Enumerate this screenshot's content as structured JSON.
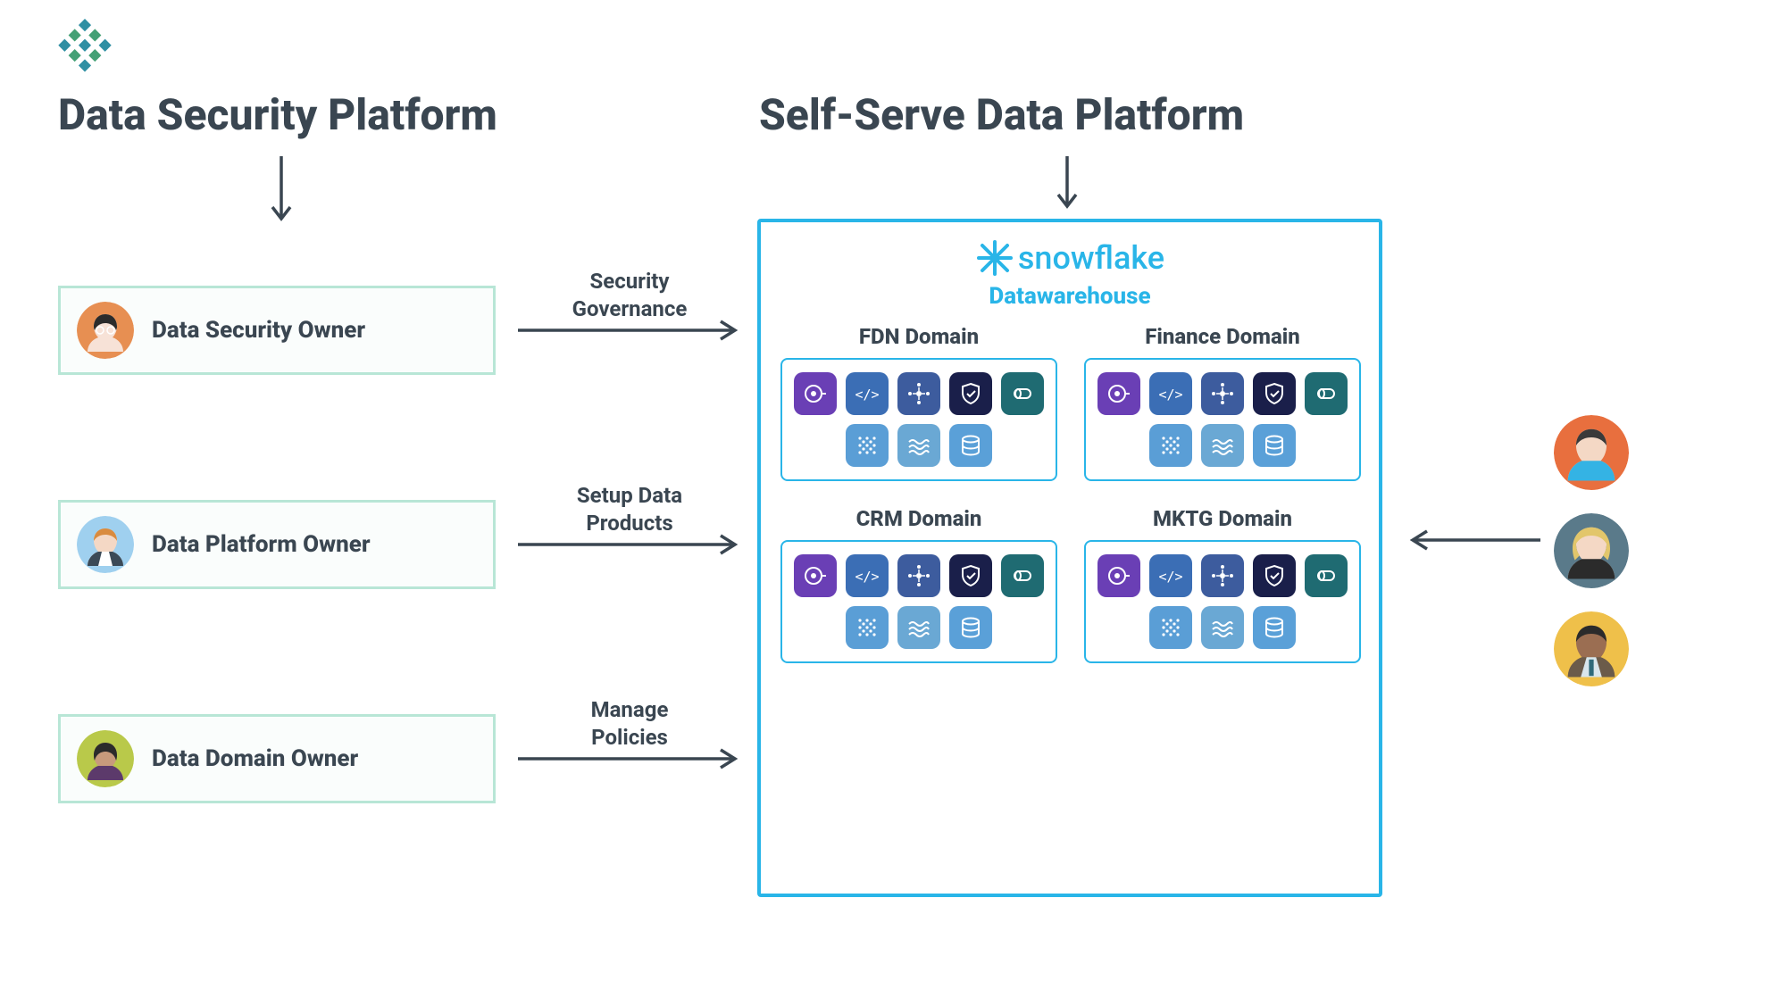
{
  "titles": {
    "left": "Data Security Platform",
    "right": "Self-Serve Data Platform"
  },
  "owners": [
    {
      "label": "Data Security Owner",
      "arrow_label": "Security\nGovernance",
      "avatar_bg": "#e78f52",
      "shirt": "#f7e2d7",
      "hair": "#2b2b2b"
    },
    {
      "label": "Data Platform Owner",
      "arrow_label": "Setup Data\nProducts",
      "avatar_bg": "#9fd0ef",
      "shirt": "#3b4a57",
      "hair": "#d98b3e"
    },
    {
      "label": "Data Domain Owner",
      "arrow_label": "Manage\nPolicies",
      "avatar_bg": "#b9c94a",
      "shirt": "#5c3a6b",
      "hair": "#2b2b2b"
    }
  ],
  "platform": {
    "brand": "snowflake",
    "subtitle": "Datawarehouse",
    "domains": [
      {
        "title": "FDN Domain"
      },
      {
        "title": "Finance Domain"
      },
      {
        "title": "CRM Domain"
      },
      {
        "title": "MKTG Domain"
      }
    ],
    "tile_palette": {
      "purple": "#6a3fb5",
      "blue": "#3b6eb5",
      "blue2": "#3d5c9e",
      "navy": "#1a1f4a",
      "teal": "#1f6b72",
      "lightblue": "#5a9ed6",
      "lightblue2": "#6aa8d4",
      "lightblue3": "#5aa0d8"
    },
    "tile_icons": [
      "ai-head",
      "code",
      "network",
      "shield",
      "storage",
      "dots",
      "waves",
      "database"
    ]
  },
  "consumers": [
    {
      "bg": "#e86f3e",
      "shirt": "#34b3e4",
      "hair": "#3a3a3a"
    },
    {
      "bg": "#5a7a8a",
      "shirt": "#2b2b2b",
      "hair": "#e2c66b"
    },
    {
      "bg": "#efc04a",
      "shirt": "#6b5b4a",
      "hair": "#2b2b2b"
    }
  ],
  "colors": {
    "text": "#3a4651",
    "snowflake": "#29b5e8",
    "card_border": "#b8e6d6"
  }
}
